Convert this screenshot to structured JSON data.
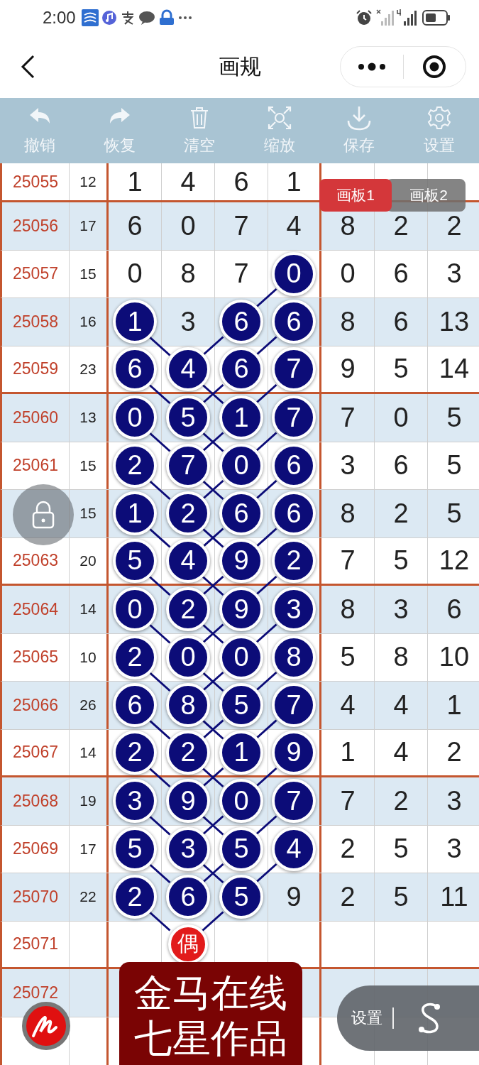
{
  "status_bar": {
    "time": "2:00"
  },
  "nav": {
    "title": "画规"
  },
  "toolbar": [
    {
      "label": "撤销",
      "kind": "undo"
    },
    {
      "label": "恢复",
      "kind": "redo"
    },
    {
      "label": "清空",
      "kind": "trash"
    },
    {
      "label": "缩放",
      "kind": "zoom"
    },
    {
      "label": "保存",
      "kind": "download"
    },
    {
      "label": "设置",
      "kind": "gear"
    }
  ],
  "board_tabs": [
    {
      "label": "画板1",
      "selected": true
    },
    {
      "label": "画板2",
      "selected": false
    }
  ],
  "table": {
    "rows": [
      {
        "period": "25055",
        "sum": "12",
        "digits": [
          {
            "value": "1",
            "kind": "digit",
            "marked": false
          },
          {
            "value": "4",
            "kind": "digit",
            "marked": false
          },
          {
            "value": "6",
            "kind": "digit",
            "marked": false
          },
          {
            "value": "1",
            "kind": "digit",
            "marked": false
          }
        ]
      },
      {
        "period": "25056",
        "sum": "17",
        "digits": [
          {
            "value": "6",
            "kind": "digit",
            "marked": false
          },
          {
            "value": "0",
            "kind": "digit",
            "marked": false
          },
          {
            "value": "7",
            "kind": "digit",
            "marked": false
          },
          {
            "value": "4",
            "kind": "digit",
            "marked": false
          }
        ],
        "extra": [
          "8",
          "2",
          "2"
        ]
      },
      {
        "period": "25057",
        "sum": "15",
        "digits": [
          {
            "value": "0",
            "kind": "digit",
            "marked": false
          },
          {
            "value": "8",
            "kind": "digit",
            "marked": false
          },
          {
            "value": "7",
            "kind": "digit",
            "marked": false
          },
          {
            "value": "0",
            "kind": "digit",
            "marked": true
          }
        ],
        "extra": [
          "0",
          "6",
          "3"
        ]
      },
      {
        "period": "25058",
        "sum": "16",
        "digits": [
          {
            "value": "1",
            "kind": "digit",
            "marked": true
          },
          {
            "value": "3",
            "kind": "digit",
            "marked": false
          },
          {
            "value": "6",
            "kind": "digit",
            "marked": true
          },
          {
            "value": "6",
            "kind": "digit",
            "marked": true
          }
        ],
        "extra": [
          "8",
          "6",
          "13"
        ]
      },
      {
        "period": "25059",
        "sum": "23",
        "digits": [
          {
            "value": "6",
            "kind": "digit",
            "marked": true
          },
          {
            "value": "4",
            "kind": "digit",
            "marked": true
          },
          {
            "value": "6",
            "kind": "digit",
            "marked": true
          },
          {
            "value": "7",
            "kind": "digit",
            "marked": true
          }
        ],
        "extra": [
          "9",
          "5",
          "14"
        ]
      },
      {
        "period": "25060",
        "sum": "13",
        "digits": [
          {
            "value": "0",
            "kind": "digit",
            "marked": true
          },
          {
            "value": "5",
            "kind": "digit",
            "marked": true
          },
          {
            "value": "1",
            "kind": "digit",
            "marked": true
          },
          {
            "value": "7",
            "kind": "digit",
            "marked": true
          }
        ],
        "extra": [
          "7",
          "0",
          "5"
        ]
      },
      {
        "period": "25061",
        "sum": "15",
        "digits": [
          {
            "value": "2",
            "kind": "digit",
            "marked": true
          },
          {
            "value": "7",
            "kind": "digit",
            "marked": true
          },
          {
            "value": "0",
            "kind": "digit",
            "marked": true
          },
          {
            "value": "6",
            "kind": "digit",
            "marked": true
          }
        ],
        "extra": [
          "3",
          "6",
          "5"
        ]
      },
      {
        "sum": "15",
        "digits": [
          {
            "value": "1",
            "kind": "digit",
            "marked": true
          },
          {
            "value": "2",
            "kind": "digit",
            "marked": true
          },
          {
            "value": "6",
            "kind": "digit",
            "marked": true
          },
          {
            "value": "6",
            "kind": "digit",
            "marked": true
          }
        ],
        "extra": [
          "8",
          "2",
          "5"
        ]
      },
      {
        "period": "25063",
        "sum": "20",
        "digits": [
          {
            "value": "5",
            "kind": "digit",
            "marked": true
          },
          {
            "value": "4",
            "kind": "digit",
            "marked": true
          },
          {
            "value": "9",
            "kind": "digit",
            "marked": true
          },
          {
            "value": "2",
            "kind": "digit",
            "marked": true
          }
        ],
        "extra": [
          "7",
          "5",
          "12"
        ]
      },
      {
        "period": "25064",
        "sum": "14",
        "digits": [
          {
            "value": "0",
            "kind": "digit",
            "marked": true
          },
          {
            "value": "2",
            "kind": "digit",
            "marked": true
          },
          {
            "value": "9",
            "kind": "digit",
            "marked": true
          },
          {
            "value": "3",
            "kind": "digit",
            "marked": true
          }
        ],
        "extra": [
          "8",
          "3",
          "6"
        ]
      },
      {
        "period": "25065",
        "sum": "10",
        "digits": [
          {
            "value": "2",
            "kind": "digit",
            "marked": true
          },
          {
            "value": "0",
            "kind": "digit",
            "marked": true
          },
          {
            "value": "0",
            "kind": "digit",
            "marked": true
          },
          {
            "value": "8",
            "kind": "digit",
            "marked": true
          }
        ],
        "extra": [
          "5",
          "8",
          "10"
        ]
      },
      {
        "period": "25066",
        "sum": "26",
        "digits": [
          {
            "value": "6",
            "kind": "digit",
            "marked": true
          },
          {
            "value": "8",
            "kind": "digit",
            "marked": true
          },
          {
            "value": "5",
            "kind": "digit",
            "marked": true
          },
          {
            "value": "7",
            "kind": "digit",
            "marked": true
          }
        ],
        "extra": [
          "4",
          "4",
          "1"
        ]
      },
      {
        "period": "25067",
        "sum": "14",
        "digits": [
          {
            "value": "2",
            "kind": "digit",
            "marked": true
          },
          {
            "value": "2",
            "kind": "digit",
            "marked": true
          },
          {
            "value": "1",
            "kind": "digit",
            "marked": true
          },
          {
            "value": "9",
            "kind": "digit",
            "marked": true
          }
        ],
        "extra": [
          "1",
          "4",
          "2"
        ]
      },
      {
        "period": "25068",
        "sum": "19",
        "digits": [
          {
            "value": "3",
            "kind": "digit",
            "marked": true
          },
          {
            "value": "9",
            "kind": "digit",
            "marked": true
          },
          {
            "value": "0",
            "kind": "digit",
            "marked": true
          },
          {
            "value": "7",
            "kind": "digit",
            "marked": true
          }
        ],
        "extra": [
          "7",
          "2",
          "3"
        ]
      },
      {
        "period": "25069",
        "sum": "17",
        "digits": [
          {
            "value": "5",
            "kind": "digit",
            "marked": true
          },
          {
            "value": "3",
            "kind": "digit",
            "marked": true
          },
          {
            "value": "5",
            "kind": "digit",
            "marked": true
          },
          {
            "value": "4",
            "kind": "digit",
            "marked": true
          }
        ],
        "extra": [
          "2",
          "5",
          "3"
        ]
      },
      {
        "period": "25070",
        "sum": "22",
        "digits": [
          {
            "value": "2",
            "kind": "digit",
            "marked": true
          },
          {
            "value": "6",
            "kind": "digit",
            "marked": true
          },
          {
            "value": "5",
            "kind": "digit",
            "marked": true
          },
          {
            "value": "9",
            "kind": "digit",
            "marked": false
          }
        ],
        "extra": [
          "2",
          "5",
          "11"
        ]
      },
      {
        "period": "25071",
        "digits": [
          {
            "kind": "empty",
            "marked": false
          },
          {
            "value": "偶",
            "kind": "parity",
            "marked": true
          },
          {
            "kind": "empty",
            "marked": false
          },
          {
            "kind": "empty",
            "marked": false
          }
        ]
      },
      {
        "period": "25072"
      }
    ]
  },
  "banner": {
    "lines": [
      "金马在线",
      "七星作品"
    ]
  },
  "float_menu": {
    "label": "设置"
  }
}
